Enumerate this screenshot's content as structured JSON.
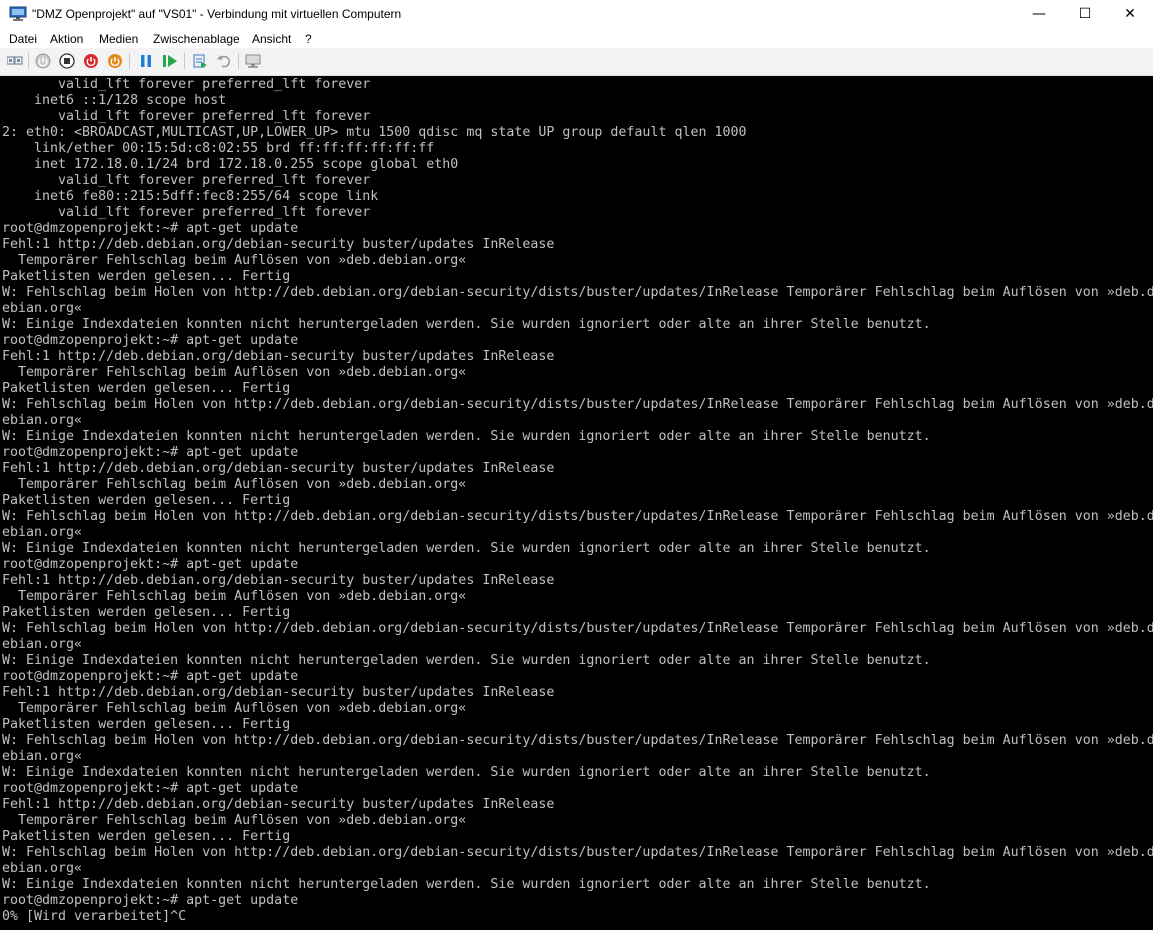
{
  "window": {
    "title": "\"DMZ Openprojekt\" auf \"VS01\" - Verbindung mit virtuellen Computern",
    "minimize_glyph": "—",
    "maximize_glyph": "☐",
    "close_glyph": "✕"
  },
  "menu": {
    "items": [
      "Datei",
      "Aktion",
      "Medien",
      "Zwischenablage",
      "Ansicht",
      "?"
    ]
  },
  "toolbar": {
    "icons": [
      "ctrl-alt-del-icon",
      "start-icon",
      "turn-off-icon",
      "shutdown-icon",
      "save-state-icon",
      "pause-icon",
      "resume-icon",
      "checkpoint-icon",
      "revert-icon",
      "enhanced-session-icon"
    ],
    "colors": {
      "red": "#d92a2a",
      "orange": "#e8891a",
      "blue": "#1f7fd6",
      "green": "#25a84a",
      "gray": "#9a9a9a"
    }
  },
  "terminal": {
    "background": "#000000",
    "foreground": "#c0c0c0",
    "lines": [
      "       valid_lft forever preferred_lft forever",
      "    inet6 ::1/128 scope host",
      "       valid_lft forever preferred_lft forever",
      "2: eth0: <BROADCAST,MULTICAST,UP,LOWER_UP> mtu 1500 qdisc mq state UP group default qlen 1000",
      "    link/ether 00:15:5d:c8:02:55 brd ff:ff:ff:ff:ff:ff",
      "    inet 172.18.0.1/24 brd 172.18.0.255 scope global eth0",
      "       valid_lft forever preferred_lft forever",
      "    inet6 fe80::215:5dff:fec8:255/64 scope link",
      "       valid_lft forever preferred_lft forever",
      "root@dmzopenprojekt:~# apt-get update",
      "Fehl:1 http://deb.debian.org/debian-security buster/updates InRelease",
      "  Temporärer Fehlschlag beim Auflösen von »deb.debian.org«",
      "Paketlisten werden gelesen... Fertig",
      "W: Fehlschlag beim Holen von http://deb.debian.org/debian-security/dists/buster/updates/InRelease Temporärer Fehlschlag beim Auflösen von »deb.d",
      "ebian.org«",
      "W: Einige Indexdateien konnten nicht heruntergeladen werden. Sie wurden ignoriert oder alte an ihrer Stelle benutzt.",
      "root@dmzopenprojekt:~# apt-get update",
      "Fehl:1 http://deb.debian.org/debian-security buster/updates InRelease",
      "  Temporärer Fehlschlag beim Auflösen von »deb.debian.org«",
      "Paketlisten werden gelesen... Fertig",
      "W: Fehlschlag beim Holen von http://deb.debian.org/debian-security/dists/buster/updates/InRelease Temporärer Fehlschlag beim Auflösen von »deb.d",
      "ebian.org«",
      "W: Einige Indexdateien konnten nicht heruntergeladen werden. Sie wurden ignoriert oder alte an ihrer Stelle benutzt.",
      "root@dmzopenprojekt:~# apt-get update",
      "Fehl:1 http://deb.debian.org/debian-security buster/updates InRelease",
      "  Temporärer Fehlschlag beim Auflösen von »deb.debian.org«",
      "Paketlisten werden gelesen... Fertig",
      "W: Fehlschlag beim Holen von http://deb.debian.org/debian-security/dists/buster/updates/InRelease Temporärer Fehlschlag beim Auflösen von »deb.d",
      "ebian.org«",
      "W: Einige Indexdateien konnten nicht heruntergeladen werden. Sie wurden ignoriert oder alte an ihrer Stelle benutzt.",
      "root@dmzopenprojekt:~# apt-get update",
      "Fehl:1 http://deb.debian.org/debian-security buster/updates InRelease",
      "  Temporärer Fehlschlag beim Auflösen von »deb.debian.org«",
      "Paketlisten werden gelesen... Fertig",
      "W: Fehlschlag beim Holen von http://deb.debian.org/debian-security/dists/buster/updates/InRelease Temporärer Fehlschlag beim Auflösen von »deb.d",
      "ebian.org«",
      "W: Einige Indexdateien konnten nicht heruntergeladen werden. Sie wurden ignoriert oder alte an ihrer Stelle benutzt.",
      "root@dmzopenprojekt:~# apt-get update",
      "Fehl:1 http://deb.debian.org/debian-security buster/updates InRelease",
      "  Temporärer Fehlschlag beim Auflösen von »deb.debian.org«",
      "Paketlisten werden gelesen... Fertig",
      "W: Fehlschlag beim Holen von http://deb.debian.org/debian-security/dists/buster/updates/InRelease Temporärer Fehlschlag beim Auflösen von »deb.d",
      "ebian.org«",
      "W: Einige Indexdateien konnten nicht heruntergeladen werden. Sie wurden ignoriert oder alte an ihrer Stelle benutzt.",
      "root@dmzopenprojekt:~# apt-get update",
      "Fehl:1 http://deb.debian.org/debian-security buster/updates InRelease",
      "  Temporärer Fehlschlag beim Auflösen von »deb.debian.org«",
      "Paketlisten werden gelesen... Fertig",
      "W: Fehlschlag beim Holen von http://deb.debian.org/debian-security/dists/buster/updates/InRelease Temporärer Fehlschlag beim Auflösen von »deb.d",
      "ebian.org«",
      "W: Einige Indexdateien konnten nicht heruntergeladen werden. Sie wurden ignoriert oder alte an ihrer Stelle benutzt.",
      "root@dmzopenprojekt:~# apt-get update",
      "0% [Wird verarbeitet]^C"
    ]
  }
}
